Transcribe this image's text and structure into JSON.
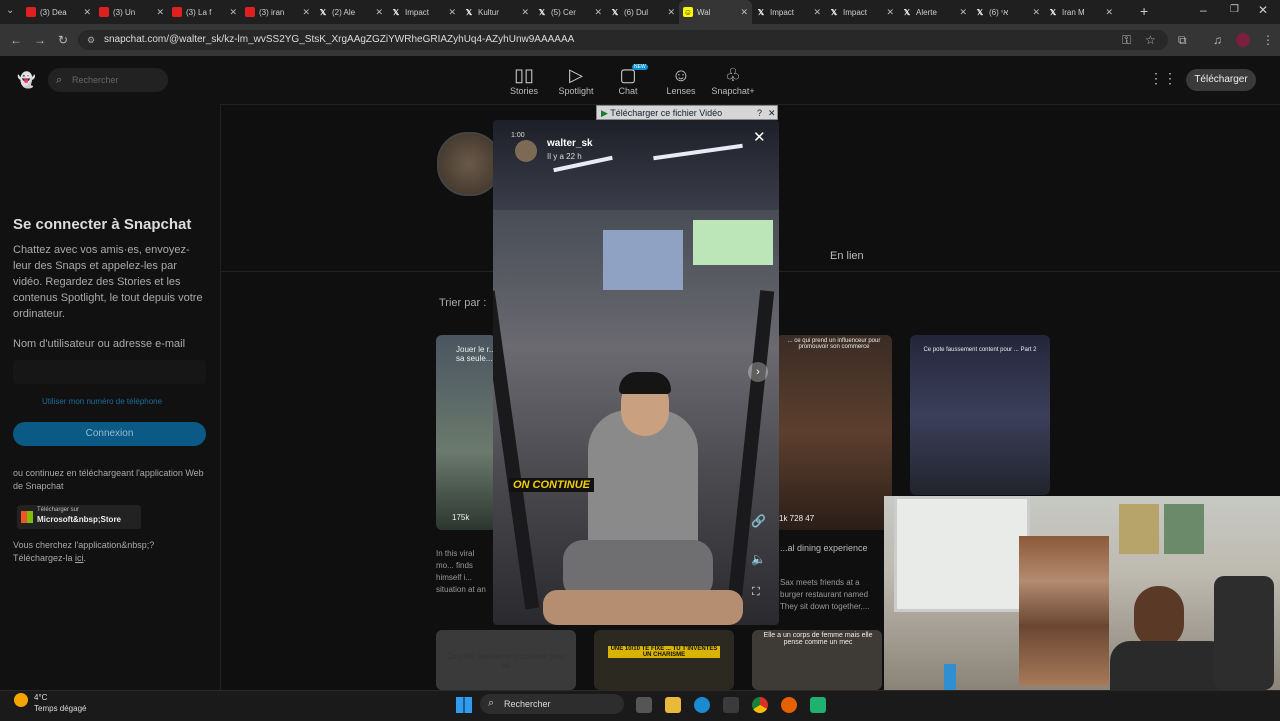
{
  "tabs": [
    {
      "label": "(3) Dea",
      "icon": "youtube-icon",
      "kind": "yt"
    },
    {
      "label": "(3) Un",
      "icon": "youtube-icon",
      "kind": "yt"
    },
    {
      "label": "(3) La f",
      "icon": "youtube-icon",
      "kind": "yt"
    },
    {
      "label": "(3) iran",
      "icon": "youtube-icon",
      "kind": "yt"
    },
    {
      "label": "(2) Ale",
      "icon": "x-icon",
      "kind": "x"
    },
    {
      "label": "Impact",
      "icon": "x-icon",
      "kind": "x"
    },
    {
      "label": "Kultur",
      "icon": "x-icon",
      "kind": "x"
    },
    {
      "label": "(5) Cer",
      "icon": "x-icon",
      "kind": "x"
    },
    {
      "label": "(6) Dul",
      "icon": "x-icon",
      "kind": "x"
    },
    {
      "label": "Wal",
      "icon": "snapchat-icon",
      "kind": "sc",
      "active": true
    },
    {
      "label": "Impact",
      "icon": "x-icon",
      "kind": "x"
    },
    {
      "label": "Impact",
      "icon": "x-icon",
      "kind": "x"
    },
    {
      "label": "Alerte",
      "icon": "x-icon",
      "kind": "x"
    },
    {
      "label": "אי (6)",
      "icon": "x-icon",
      "kind": "x"
    },
    {
      "label": "Iran M",
      "icon": "x-icon",
      "kind": "x"
    }
  ],
  "address": {
    "url": "snapchat.com/@walter_sk/kz-lm_wvSS2YG_StsK_XrgAAgZGZiYWRheGRIAZyhUq4-AZyhUnw9AAAAAA"
  },
  "header": {
    "search_placeholder": "Rechercher",
    "nav": [
      {
        "label": "Stories",
        "icon": "stories-icon",
        "glyph": "▯▯"
      },
      {
        "label": "Spotlight",
        "icon": "spotlight-play-icon",
        "glyph": "▷"
      },
      {
        "label": "Chat",
        "icon": "chat-icon",
        "glyph": "▢",
        "badge": "NEW"
      },
      {
        "label": "Lenses",
        "icon": "lenses-icon",
        "glyph": "☺"
      },
      {
        "label": "Snapchat+",
        "icon": "snapchat-plus-icon",
        "glyph": "♧"
      }
    ],
    "download_label": "Télécharger"
  },
  "left": {
    "title": "Se connecter à Snapchat",
    "description": "Chattez avec vos amis·es, envoyez-leur des Snaps et appelez-les par vidéo. Regardez des Stories et les contenus Spotlight, le tout depuis votre ordinateur.",
    "field_label": "Nom d'utilisateur ou adresse e-mail",
    "phone_link": "Utiliser mon numéro de téléphone",
    "login_button": "Connexion",
    "app_text": "ou continuez en téléchargeant l'application Web de Snapchat",
    "ms_small": "Télécharger sur",
    "ms_store": "Microsoft&nbsp;Store",
    "footer_q": "Vous cherchez l'application&nbsp;?",
    "footer_a": "Téléchargez-la ",
    "footer_link": "ici",
    "footer_end": "."
  },
  "main": {
    "tab_label": "En lien",
    "sort_label": "Trier par :",
    "cards": [
      {
        "caption": "Jouer le r... sa seule...",
        "stats": "175k",
        "desc": "In this viral mo... finds himself i... situation at an"
      },
      {
        "caption": "... ce qui prend un influenceur pour promouvoir son commerce",
        "stats": "1k  728  47",
        "desc": "...al dining experience",
        "desc2": "Sax meets friends at a burger restaurant named They sit down together,..."
      },
      {
        "caption": "Ce pote faussement content pour ... Part 2",
        "stats": "",
        "desc": ""
      }
    ],
    "bottom_cards": [
      {
        "caption": "Ce pote faussement content pour toi"
      },
      {
        "caption": "UNE 10/10 TE FIXE ... TU T'INVENTES UN CHARISME"
      },
      {
        "caption": "Elle a un corps de femme mais elle pense comme un mec"
      }
    ]
  },
  "video": {
    "download_bar": "Télécharger ce fichier Vidéo",
    "username": "walter_sk",
    "time": "Il y a 22 h",
    "progress_time": "1:00",
    "subtitle": "ON CONTINUE"
  },
  "taskbar": {
    "weather_temp": "4°C",
    "weather_desc": "Temps dégagé",
    "search": "Rechercher"
  }
}
